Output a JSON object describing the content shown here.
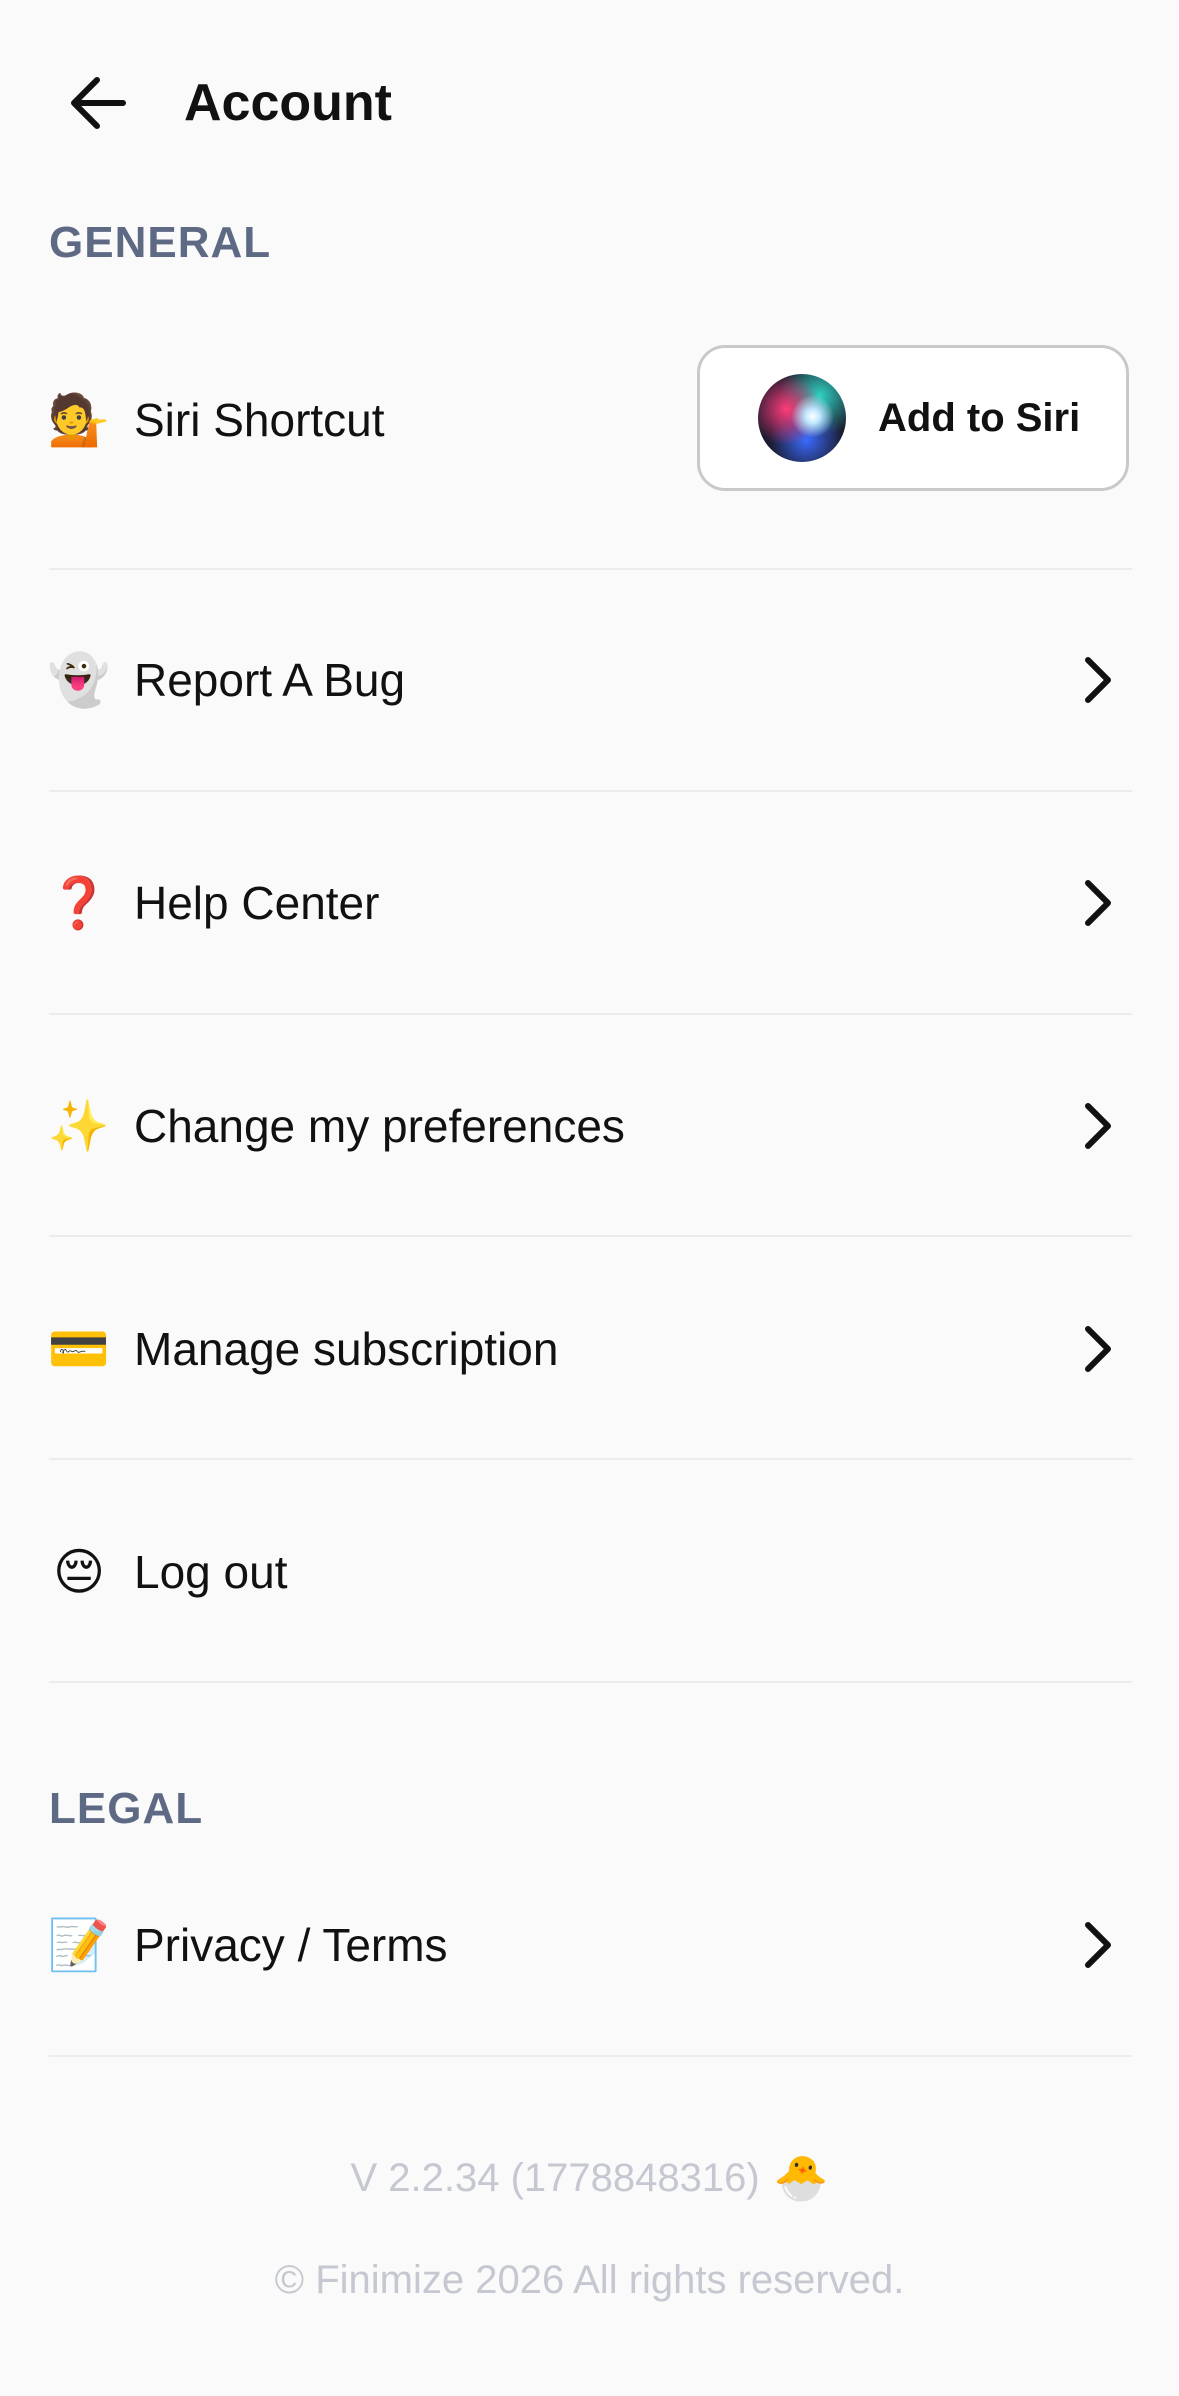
{
  "header": {
    "title": "Account"
  },
  "sections": {
    "general_label": "GENERAL",
    "legal_label": "LEGAL"
  },
  "siri": {
    "emoji": "💁",
    "label": "Siri Shortcut",
    "button_label": "Add to Siri"
  },
  "general_items": [
    {
      "emoji": "👻",
      "label": "Report A Bug"
    },
    {
      "emoji": "❓",
      "label": "Help Center"
    },
    {
      "emoji": "✨",
      "label": "Change my preferences"
    },
    {
      "emoji": "💳",
      "label": "Manage subscription"
    },
    {
      "emoji": "😔",
      "label": "Log out"
    }
  ],
  "legal_items": [
    {
      "emoji": "📝",
      "label": "Privacy / Terms"
    }
  ],
  "footer": {
    "version": "V 2.2.34 (1778848316)",
    "version_emoji": "🐣",
    "copyright": "© Finimize 2026 All rights reserved."
  },
  "colors": {
    "background": "#FAFAFA",
    "section_label": "#5E6A84",
    "divider": "#ECECEC",
    "footer_text": "#C5C8D0"
  },
  "icons": {
    "back": "arrow-left-icon",
    "chevron": "chevron-right-icon",
    "siri": "siri-orb-icon"
  }
}
